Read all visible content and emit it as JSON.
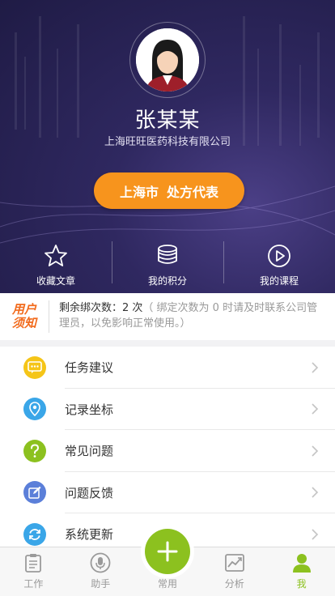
{
  "profile": {
    "name": "张某某",
    "company": "上海旺旺医药科技有限公司",
    "role_city": "上海市",
    "role_title": "处方代表"
  },
  "quick_links": [
    {
      "label": "收藏文章",
      "icon": "star-icon"
    },
    {
      "label": "我的积分",
      "icon": "coins-icon"
    },
    {
      "label": "我的课程",
      "icon": "play-circle-icon"
    }
  ],
  "notice": {
    "logo_line1": "用户",
    "logo_line2": "须知",
    "remaining": "剩余绑次数：2 次",
    "hint": "（ 绑定次数为 0 时请及时联系公司管理员，以免影响正常使用。）"
  },
  "menu": [
    {
      "label": "任务建议",
      "icon": "chat-icon",
      "color": "#f5c518"
    },
    {
      "label": "记录坐标",
      "icon": "location-pin-icon",
      "color": "#3aa6e8"
    },
    {
      "label": "常见问题",
      "icon": "question-icon",
      "color": "#8cc11f"
    },
    {
      "label": "问题反馈",
      "icon": "edit-icon",
      "color": "#5b7fd9"
    },
    {
      "label": "系统更新",
      "icon": "refresh-icon",
      "color": "#3aa6e8"
    }
  ],
  "tabs": [
    {
      "label": "工作",
      "icon": "clipboard-icon",
      "active": false
    },
    {
      "label": "助手",
      "icon": "microphone-icon",
      "active": false
    },
    {
      "label": "常用",
      "icon": "plus-icon",
      "active": false
    },
    {
      "label": "分析",
      "icon": "chart-icon",
      "active": false
    },
    {
      "label": "我",
      "icon": "person-icon",
      "active": true
    }
  ],
  "colors": {
    "accent_green": "#8cc11f",
    "role_orange": "#f7941d",
    "header_purple": "#2f2860"
  }
}
